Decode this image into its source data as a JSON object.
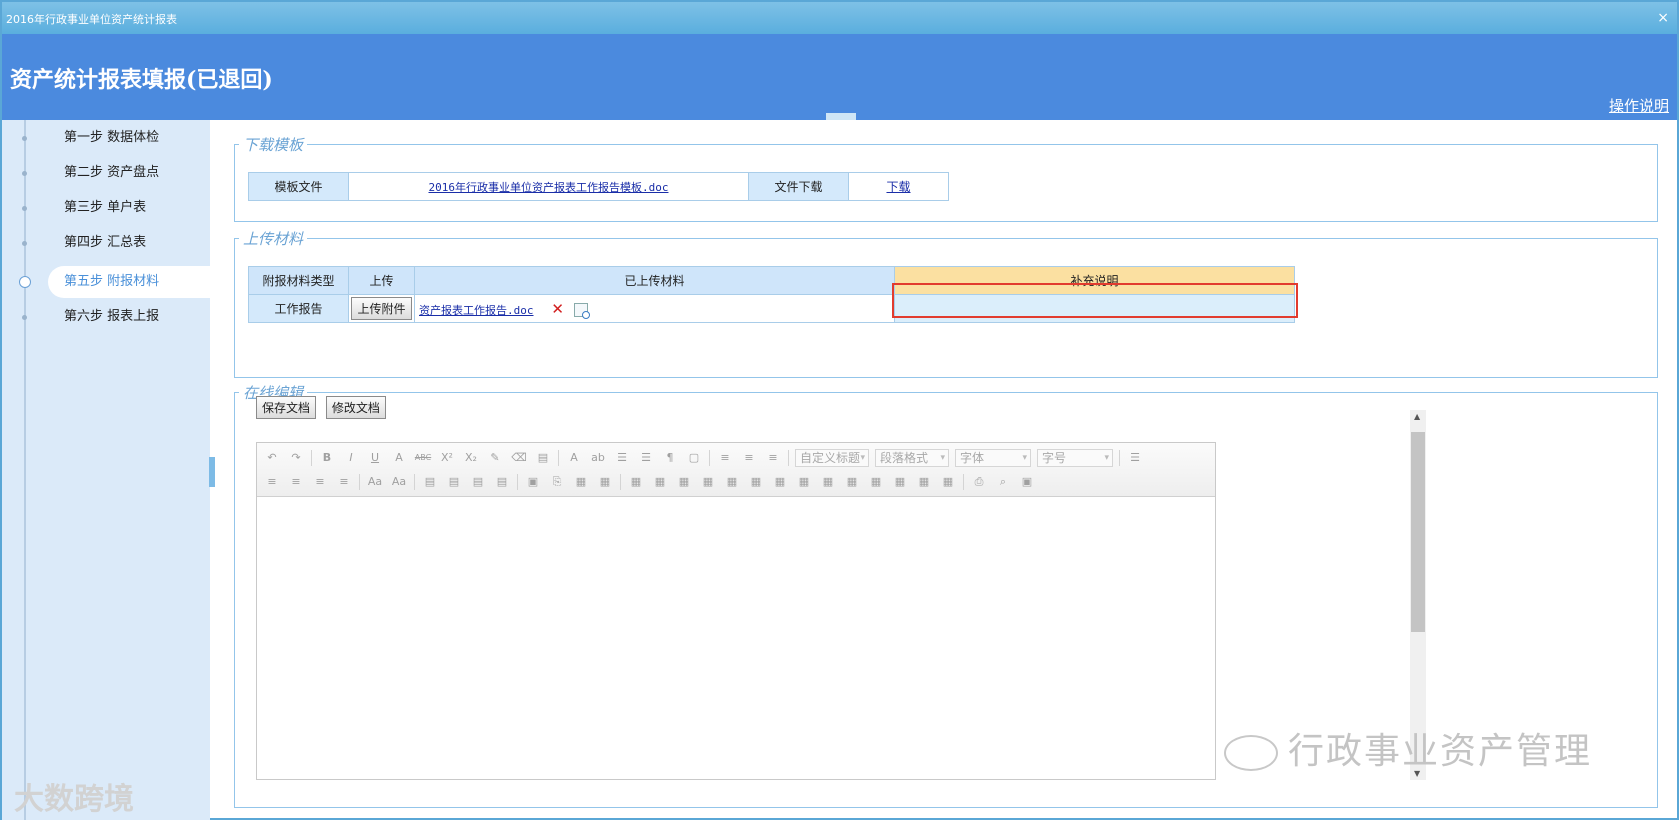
{
  "window": {
    "title": "2016年行政事业单位资产统计报表",
    "close_glyph": "×"
  },
  "banner": {
    "heading": "资产统计报表填报(已退回)",
    "help_link": "操作说明"
  },
  "steps": [
    {
      "label": "第一步 数据体检"
    },
    {
      "label": "第二步 资产盘点"
    },
    {
      "label": "第三步 单户表"
    },
    {
      "label": "第四步 汇总表"
    },
    {
      "label": "第五步 附报材料",
      "active": true
    },
    {
      "label": "第六步 报表上报"
    }
  ],
  "download_section": {
    "legend": "下载模板",
    "template_label": "模板文件",
    "template_file": "2016年行政事业单位资产报表工作报告模板.doc",
    "download_label": "文件下载",
    "download_link": "下载"
  },
  "upload_section": {
    "legend": "上传材料",
    "headers": {
      "type": "附报材料类型",
      "upload": "上传",
      "uploaded": "已上传材料",
      "note": "补充说明"
    },
    "row": {
      "type": "工作报告",
      "upload_button": "上传附件",
      "uploaded_file": "资产报表工作报告.doc",
      "note": ""
    },
    "delete_glyph": "✕"
  },
  "online_edit": {
    "legend": "在线编辑",
    "save_button": "保存文档",
    "edit_button": "修改文档",
    "toolbar": {
      "row1_glyphs": [
        "↶",
        "↷",
        "B",
        "I",
        "U",
        "A",
        "ABC",
        "X²",
        "X₂",
        "✎",
        "⌫",
        "▤",
        "A",
        "ab",
        "☰",
        "☰",
        "¶",
        "▢",
        "≡",
        "≡",
        "≡"
      ],
      "title_select": "自定义标题",
      "paragraph_select": "段落格式",
      "font_select": "字体",
      "size_select": "字号",
      "row2_glyphs": [
        "≡",
        "≡",
        "≡",
        "≡",
        "Aa",
        "Aa",
        "▤",
        "▤",
        "▤",
        "▤",
        "▣",
        "⎘",
        "▦",
        "▦",
        "▦",
        "▦",
        "▦",
        "▦",
        "▦",
        "▦",
        "▦",
        "▦",
        "▦",
        "▦",
        "▦",
        "▦",
        "▦",
        "▦",
        "⎙",
        "⌕",
        "▣"
      ]
    }
  },
  "watermark": {
    "right": "行政事业资产管理",
    "left": "大数跨境"
  }
}
